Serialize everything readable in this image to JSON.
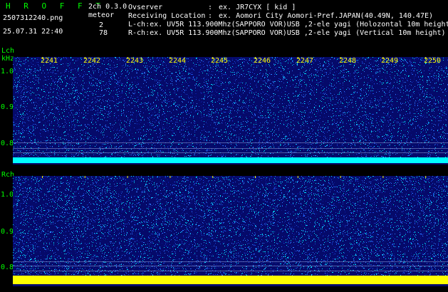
{
  "header": {
    "brand": "H R O F F T",
    "filename": "2507312240.png",
    "timestamp": "25.07.31 22:40",
    "version": "2ch 0.3.0",
    "meteor_label": "meteor",
    "lch_count": "2",
    "rch_count": "78"
  },
  "info": {
    "observer_label": "Ovserver",
    "observer_sep": ":",
    "observer_value": "ex. JR7CYX [ kid ]",
    "location_label": "Receiving Location",
    "location_sep": ":",
    "location_value": "ex. Aomori City Aomori-Pref.JAPAN(40.49N, 140.47E)",
    "lch_line": "L-ch:ex. UV5R 113.900Mhz(SAPPORO VOR)USB ,2-ele yagi (Holozontal 10m height)",
    "rch_line": "R-ch:ex. UV5R 113.900Mhz(SAPPORO VOR)USB ,2-ele yagi (Vertical 10m height)"
  },
  "lch": {
    "name": "Lch",
    "unit": "kHz",
    "yticks": [
      "1.0",
      "0.9",
      "0.8"
    ]
  },
  "rch": {
    "name": "Rch",
    "yticks": [
      "1.0",
      "0.9",
      "0.8"
    ]
  },
  "time_axis": {
    "labels": [
      "2241",
      "2242",
      "2243",
      "2244",
      "2245",
      "2246",
      "2247",
      "2248",
      "2249",
      "2250"
    ]
  },
  "colors": {
    "background": "#000000",
    "label_green": "#00ff00",
    "time_yellow": "#ffff00",
    "noise_dark_blue": "#0a1a9c",
    "noise_light_blue": "#2f7dff",
    "noise_cyan": "#00e6ff",
    "carrier_cyan": "#00ffff",
    "carrier_yellow": "#ffff00"
  }
}
